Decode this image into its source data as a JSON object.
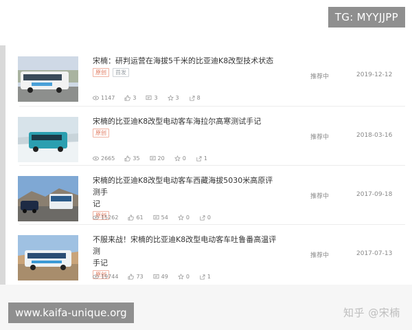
{
  "watermarks": {
    "tg": "TG: MYYJJPP",
    "site": "www.kaifa-unique.org",
    "zhihu": "知乎 @宋楠"
  },
  "articles": [
    {
      "title_line1": "宋楠：研判运营在海拔5千米的比亚迪K8改型技术状态",
      "title_line2": "",
      "badges": [
        "原创",
        "首发"
      ],
      "status": "推荐中",
      "date": "2019-12-12",
      "views": "1147",
      "likes": "3",
      "comments": "3",
      "favorites": "3",
      "shares": "8"
    },
    {
      "title_line1": "宋楠的比亚迪K8改型电动客车海拉尔高寒测试手记",
      "title_line2": "",
      "badges": [
        "原创"
      ],
      "status": "推荐中",
      "date": "2018-03-16",
      "views": "2665",
      "likes": "35",
      "comments": "20",
      "favorites": "0",
      "shares": "1"
    },
    {
      "title_line1": "宋楠的比亚迪K8改型电动客车西藏海拔5030米高原评测手",
      "title_line2": "记",
      "badges": [
        "原创"
      ],
      "status": "推荐中",
      "date": "2017-09-18",
      "views": "15262",
      "likes": "61",
      "comments": "54",
      "favorites": "0",
      "shares": "0"
    },
    {
      "title_line1": "不服来战！宋楠的比亚迪K8改型电动客车吐鲁番高温评测",
      "title_line2": "手记",
      "badges": [
        "原创"
      ],
      "status": "推荐中",
      "date": "2017-07-13",
      "views": "19744",
      "likes": "73",
      "comments": "49",
      "favorites": "0",
      "shares": "1"
    }
  ],
  "colors": {
    "badge_original": "#e07a5f",
    "badge_other": "#9aa0a6",
    "meta_text": "#888888"
  },
  "icons": [
    "eye-icon",
    "thumbs-up-icon",
    "comment-icon",
    "star-icon",
    "share-icon"
  ]
}
